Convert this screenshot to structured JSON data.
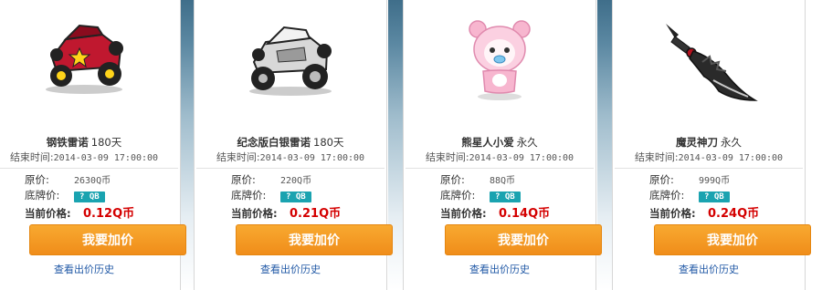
{
  "labels": {
    "end_time": "结束时间:",
    "original_price": "原价:",
    "floor_price": "底牌价:",
    "current_price": "当前价格:",
    "floor_badge": "? QB",
    "bid_button": "我要加价",
    "history_link": "查看出价历史"
  },
  "items": [
    {
      "name": "钢铁雷诺",
      "duration": "180天",
      "end_time": "2014-03-09 17:00:00",
      "original_price": "2630Q币",
      "current_price": "0.12Q币",
      "image_icon": "red-racing-kart-image"
    },
    {
      "name": "纪念版白银雷诺",
      "duration": "180天",
      "end_time": "2014-03-09 17:00:00",
      "original_price": "220Q币",
      "current_price": "0.21Q币",
      "image_icon": "silver-racing-kart-image"
    },
    {
      "name": "熊星人小爱",
      "duration": "永久",
      "end_time": "2014-03-09 17:00:00",
      "original_price": "88Q币",
      "current_price": "0.14Q币",
      "image_icon": "pink-bear-pet-image"
    },
    {
      "name": "魔灵神刀",
      "duration": "永久",
      "end_time": "2014-03-09 17:00:00",
      "original_price": "999Q币",
      "current_price": "0.24Q币",
      "image_icon": "dark-blade-image"
    }
  ],
  "colors": {
    "button": "#f39b22",
    "price": "#d40000",
    "badge": "#1aa3b0",
    "link": "#2159a6"
  }
}
